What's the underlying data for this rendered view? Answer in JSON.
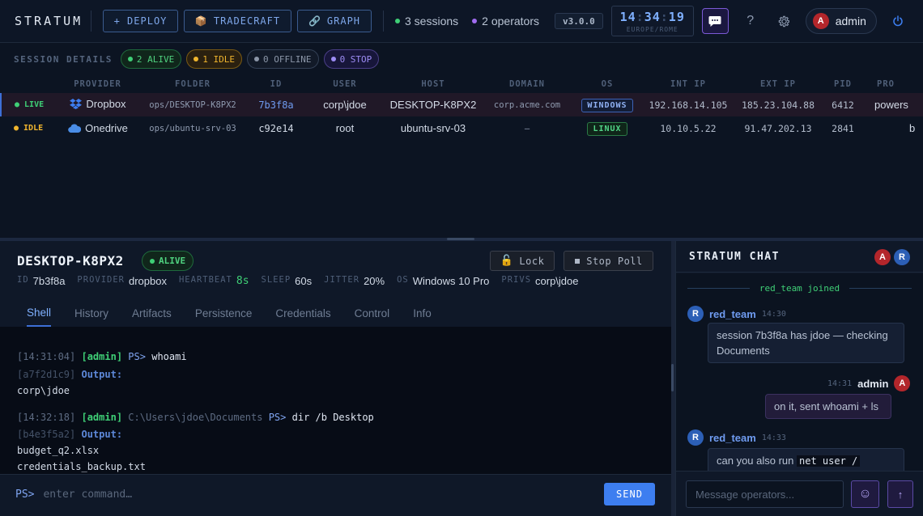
{
  "app": {
    "title": "STRATUM"
  },
  "toolbar": {
    "deploy": "+ DEPLOY",
    "tradecraft": "TRADECRAFT",
    "graph": "GRAPH",
    "sessions": "3 sessions",
    "operators": "2 operators",
    "version": "v3.0.0",
    "clock": {
      "h": "14",
      "m": "34",
      "s": "19",
      "zone": "EUROPE/ROME"
    },
    "help": "?",
    "user": {
      "initial": "A",
      "name": "admin"
    }
  },
  "sessions": {
    "title": "SESSION DETAILS",
    "pills": {
      "alive": "2 ALIVE",
      "idle": "1 IDLE",
      "offline": "0 OFFLINE",
      "stop": "0 STOP"
    },
    "columns": [
      "",
      "PROVIDER",
      "FOLDER",
      "ID",
      "USER",
      "HOST",
      "DOMAIN",
      "OS",
      "INT IP",
      "EXT IP",
      "PID",
      "PRO"
    ],
    "rows": [
      {
        "status": "● LIVE",
        "provider": "Dropbox",
        "folder": "ops/DESKTOP-K8PX2",
        "id": "7b3f8a",
        "user": "corp\\jdoe",
        "host": "DESKTOP-K8PX2",
        "domain": "corp.acme.com",
        "os": "WINDOWS",
        "int_ip": "192.168.14.105",
        "ext_ip": "185.23.104.88",
        "pid": "6412",
        "proc": "powers"
      },
      {
        "status": "● IDLE",
        "provider": "Onedrive",
        "folder": "ops/ubuntu-srv-03",
        "id": "c92e14",
        "user": "root",
        "host": "ubuntu-srv-03",
        "domain": "—",
        "os": "LINUX",
        "int_ip": "10.10.5.22",
        "ext_ip": "91.47.202.13",
        "pid": "2841",
        "proc": "b"
      }
    ]
  },
  "detail": {
    "host": "DESKTOP-K8PX2",
    "status": "ALIVE",
    "lock": "Lock",
    "stop_poll": "Stop Poll",
    "meta": {
      "id_k": "ID",
      "id_v": "7b3f8a",
      "provider_k": "PROVIDER",
      "provider_v": "dropbox",
      "heartbeat_k": "HEARTBEAT",
      "heartbeat_v": "8s",
      "sleep_k": "SLEEP",
      "sleep_v": "60s",
      "jitter_k": "JITTER",
      "jitter_v": "20%",
      "os_k": "OS",
      "os_v": "Windows 10 Pro",
      "privs_k": "PRIVS",
      "privs_v": "corp\\jdoe"
    },
    "tabs": [
      "Shell",
      "History",
      "Artifacts",
      "Persistence",
      "Credentials",
      "Control",
      "Info"
    ]
  },
  "terminal": {
    "entries": [
      {
        "ts": "[14:31:04]",
        "user": "[admin]",
        "cwd": "",
        "prompt": "PS>",
        "cmd": "whoami",
        "hash": "[a7f2d1c9]",
        "output_label": "Output:",
        "output": [
          "corp\\jdoe"
        ]
      },
      {
        "ts": "[14:32:18]",
        "user": "[admin]",
        "cwd": "C:\\Users\\jdoe\\Documents",
        "prompt": "PS>",
        "cmd": "dir /b Desktop",
        "hash": "[b4e3f5a2]",
        "output_label": "Output:",
        "output": [
          "budget_q2.xlsx",
          "credentials_backup.txt"
        ]
      }
    ],
    "prompt": "PS>",
    "placeholder": "enter command…",
    "send": "SEND"
  },
  "chat": {
    "title": "STRATUM CHAT",
    "participants": [
      {
        "initial": "A",
        "color": "#b3262b"
      },
      {
        "initial": "R",
        "color": "#2c5fb6"
      }
    ],
    "joined": "red_team joined",
    "messages": [
      {
        "initial": "R",
        "name": "red_team",
        "time": "14:30",
        "text": "session 7b3f8a has jdoe — checking Documents"
      },
      {
        "initial": "A",
        "name": "admin",
        "time": "14:31",
        "text": "on it, sent whoami + ls"
      },
      {
        "initial": "R",
        "name": "red_team",
        "time": "14:33",
        "text": "can you also run",
        "code": "net user /"
      }
    ],
    "placeholder": "Message operators..."
  },
  "colors": {
    "accent": "#3d7ef0",
    "alive": "#3fcf76",
    "idle": "#f0b52e",
    "stop": "#9d8cf5",
    "chat_accent": "#7b5ad6"
  }
}
